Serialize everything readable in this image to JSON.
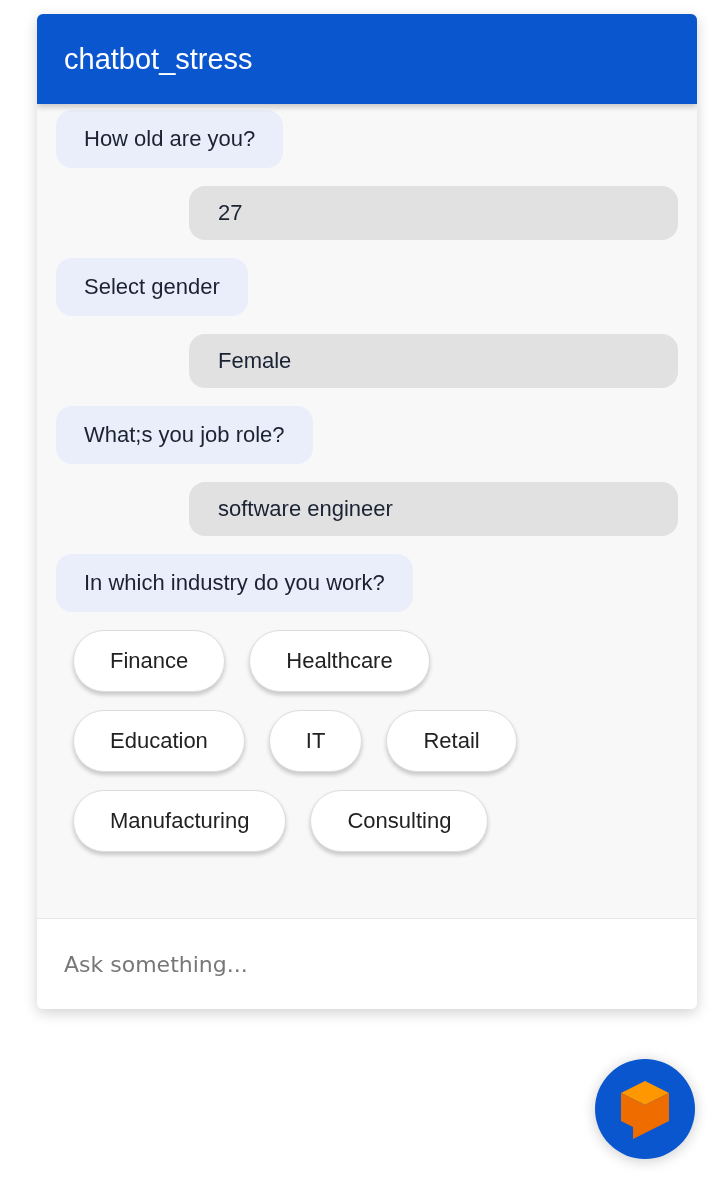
{
  "window": {
    "title": "chatbot_stress"
  },
  "messages": [
    {
      "kind": "bot",
      "text": "How old are you?"
    },
    {
      "kind": "user",
      "text": "27"
    },
    {
      "kind": "bot",
      "text": "Select gender"
    },
    {
      "kind": "user",
      "text": "Female"
    },
    {
      "kind": "bot",
      "text": "What;s you job role?"
    },
    {
      "kind": "user",
      "text": "software engineer"
    },
    {
      "kind": "bot",
      "text": "In which industry do you work?"
    }
  ],
  "quick_replies": [
    [
      "Finance",
      "Healthcare"
    ],
    [
      "Education",
      "IT",
      "Retail"
    ],
    [
      "Manufacturing",
      "Consulting"
    ]
  ],
  "input": {
    "placeholder": "Ask something..."
  }
}
